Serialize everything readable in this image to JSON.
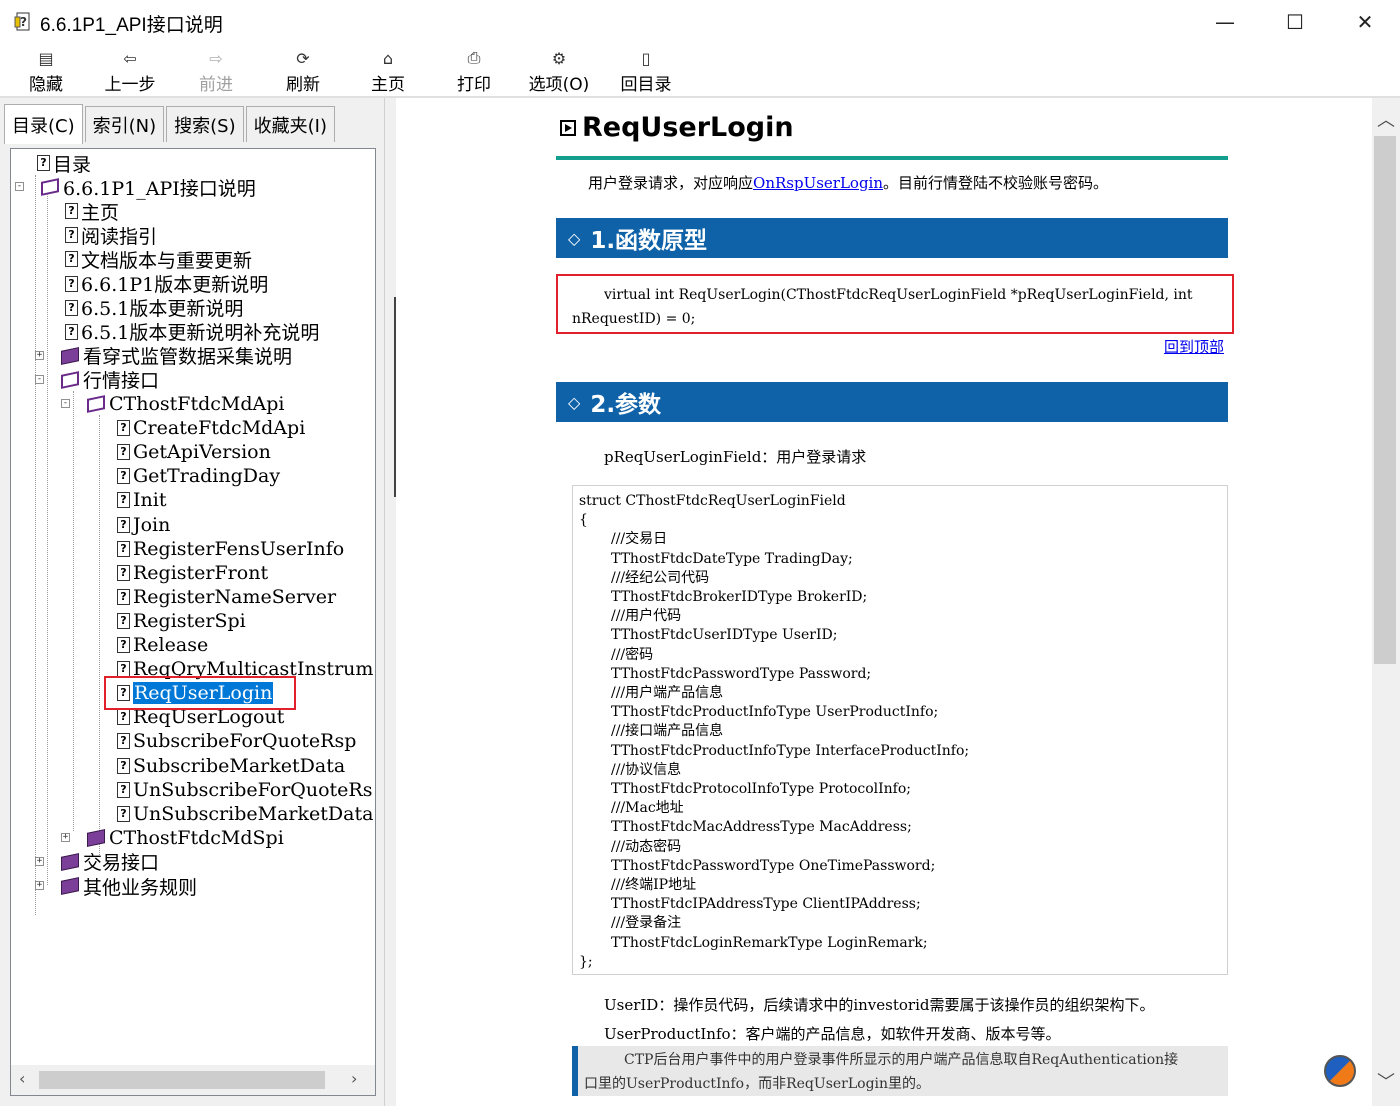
{
  "window": {
    "title": "6.6.1P1_API接口说明",
    "minimize": "—",
    "maximize": "☐",
    "close": "✕"
  },
  "toolbar": {
    "hide": "隐藏",
    "back": "上一步",
    "forward": "前进",
    "refresh": "刷新",
    "home": "主页",
    "print": "打印",
    "options": "选项(O)",
    "toc_return": "回目录"
  },
  "tabs": {
    "contents": "目录(C)",
    "index": "索引(N)",
    "search": "搜索(S)",
    "favorites": "收藏夹(I)"
  },
  "tree": [
    {
      "label": "目录"
    },
    {
      "label": "6.6.1P1_API接口说明"
    },
    {
      "label": "主页"
    },
    {
      "label": "阅读指引"
    },
    {
      "label": "文档版本与重要更新"
    },
    {
      "label": "6.6.1P1版本更新说明"
    },
    {
      "label": "6.5.1版本更新说明"
    },
    {
      "label": "6.5.1版本更新说明补充说明"
    },
    {
      "label": "看穿式监管数据采集说明"
    },
    {
      "label": "行情接口"
    },
    {
      "label": "CThostFtdcMdApi"
    },
    {
      "label": "CreateFtdcMdApi"
    },
    {
      "label": "GetApiVersion"
    },
    {
      "label": "GetTradingDay"
    },
    {
      "label": "Init"
    },
    {
      "label": "Join"
    },
    {
      "label": "RegisterFensUserInfo"
    },
    {
      "label": "RegisterFront"
    },
    {
      "label": "RegisterNameServer"
    },
    {
      "label": "RegisterSpi"
    },
    {
      "label": "Release"
    },
    {
      "label": "ReqQryMulticastInstrument"
    },
    {
      "label": "ReqUserLogin"
    },
    {
      "label": "ReqUserLogout"
    },
    {
      "label": "SubscribeForQuoteRsp"
    },
    {
      "label": "SubscribeMarketData"
    },
    {
      "label": "UnSubscribeForQuoteRsp"
    },
    {
      "label": "UnSubscribeMarketData"
    },
    {
      "label": "CThostFtdcMdSpi"
    },
    {
      "label": "交易接口"
    },
    {
      "label": "其他业务规则"
    }
  ],
  "scroll": {
    "left": "‹",
    "right": "›",
    "up": "︿",
    "down": "﹀"
  },
  "content": {
    "title": "ReqUserLogin",
    "intro_before": "用户登录请求，对应响应",
    "intro_link": "OnRspUserLogin",
    "intro_after": "。目前行情登陆不校验账号密码。",
    "section1": "1.函数原型",
    "proto_line1": "virtual int ReqUserLogin(CThostFtdcReqUserLoginField *pReqUserLoginField, int",
    "proto_line2": "nRequestID) = 0;",
    "back_to_top": "回到顶部",
    "section2": "2.参数",
    "param_line": "pReqUserLoginField：用户登录请求",
    "struct_lines": [
      {
        "text": "struct CThostFtdcReqUserLoginField",
        "indent": false
      },
      {
        "text": "{",
        "indent": false
      },
      {
        "text": "///交易日",
        "indent": true
      },
      {
        "text": "TThostFtdcDateType TradingDay;",
        "indent": true
      },
      {
        "text": "///经纪公司代码",
        "indent": true
      },
      {
        "text": "TThostFtdcBrokerIDType BrokerID;",
        "indent": true
      },
      {
        "text": "///用户代码",
        "indent": true
      },
      {
        "text": "TThostFtdcUserIDType UserID;",
        "indent": true
      },
      {
        "text": "///密码",
        "indent": true
      },
      {
        "text": "TThostFtdcPasswordType Password;",
        "indent": true
      },
      {
        "text": "///用户端产品信息",
        "indent": true
      },
      {
        "text": "TThostFtdcProductInfoType UserProductInfo;",
        "indent": true
      },
      {
        "text": "///接口端产品信息",
        "indent": true
      },
      {
        "text": "TThostFtdcProductInfoType InterfaceProductInfo;",
        "indent": true
      },
      {
        "text": "///协议信息",
        "indent": true
      },
      {
        "text": "TThostFtdcProtocolInfoType ProtocolInfo;",
        "indent": true
      },
      {
        "text": "///Mac地址",
        "indent": true
      },
      {
        "text": "TThostFtdcMacAddressType MacAddress;",
        "indent": true
      },
      {
        "text": "///动态密码",
        "indent": true
      },
      {
        "text": "TThostFtdcPasswordType OneTimePassword;",
        "indent": true
      },
      {
        "text": "///终端IP地址",
        "indent": true
      },
      {
        "text": "TThostFtdcIPAddressType ClientIPAddress;",
        "indent": true
      },
      {
        "text": "///登录备注",
        "indent": true
      },
      {
        "text": "TThostFtdcLoginRemarkType LoginRemark;",
        "indent": true
      },
      {
        "text": "};",
        "indent": false
      }
    ],
    "desc_userid": "UserID：操作员代码，后续请求中的investorid需要属于该操作员的组织架构下。",
    "desc_product": "UserProductInfo：客户端的产品信息，如软件开发商、版本号等。",
    "note_line1": "CTP后台用户事件中的用户登录事件所显示的用户端产品信息取自ReqAuthentication接",
    "note_line2": "口里的UserProductInfo，而非ReqUserLogin里的。"
  }
}
